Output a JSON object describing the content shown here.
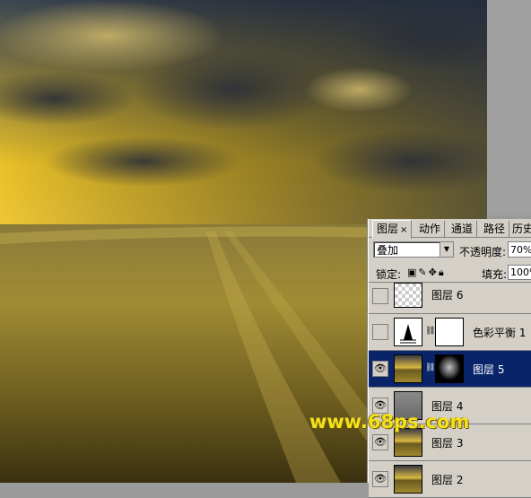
{
  "panel": {
    "tabs": [
      {
        "label": "图层",
        "close": "×"
      },
      {
        "label": "动作"
      },
      {
        "label": "通道"
      },
      {
        "label": "路径"
      },
      {
        "label": "历史"
      }
    ],
    "blend_mode": "叠加",
    "opacity_label": "不透明度:",
    "opacity_value": "70%",
    "lock_label": "锁定:",
    "fill_label": "填充:",
    "fill_value": "100%",
    "layers": [
      {
        "name": "图层 6",
        "visible": false,
        "thumb": "checker"
      },
      {
        "name": "色彩平衡 1",
        "visible": false,
        "thumb": "adjustment",
        "mask": "white"
      },
      {
        "name": "图层 5",
        "visible": true,
        "thumb": "field",
        "mask": "dark",
        "selected": true
      },
      {
        "name": "图层 4",
        "visible": true,
        "thumb": "gray"
      },
      {
        "name": "图层 3",
        "visible": true,
        "thumb": "field"
      },
      {
        "name": "图层 2",
        "visible": true,
        "thumb": "field"
      }
    ]
  },
  "watermark": "www.68ps.com"
}
